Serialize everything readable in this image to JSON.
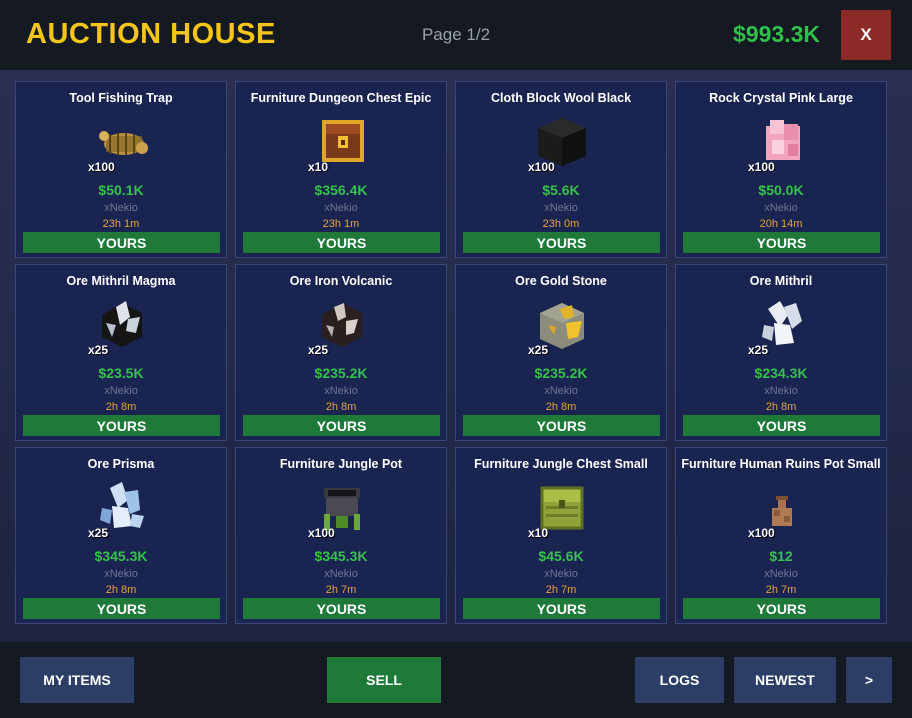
{
  "header": {
    "title": "AUCTION HOUSE",
    "page_indicator": "Page 1/2",
    "balance": "$993.3K",
    "close_label": "X"
  },
  "items": [
    {
      "name": "Tool Fishing Trap",
      "qty": "x100",
      "price": "$50.1K",
      "seller": "xNekio",
      "time": "23h 1m",
      "status": "YOURS",
      "icon": "fishing-trap-icon"
    },
    {
      "name": "Furniture Dungeon Chest Epic",
      "qty": "x10",
      "price": "$356.4K",
      "seller": "xNekio",
      "time": "23h 1m",
      "status": "YOURS",
      "icon": "dungeon-chest-icon"
    },
    {
      "name": "Cloth Block Wool Black",
      "qty": "x100",
      "price": "$5.6K",
      "seller": "xNekio",
      "time": "23h 0m",
      "status": "YOURS",
      "icon": "black-wool-block-icon"
    },
    {
      "name": "Rock Crystal Pink Large",
      "qty": "x100",
      "price": "$50.0K",
      "seller": "xNekio",
      "time": "20h 14m",
      "status": "YOURS",
      "icon": "pink-crystal-icon"
    },
    {
      "name": "Ore Mithril Magma",
      "qty": "x25",
      "price": "$23.5K",
      "seller": "xNekio",
      "time": "2h 8m",
      "status": "YOURS",
      "icon": "mithril-magma-ore-icon"
    },
    {
      "name": "Ore Iron Volcanic",
      "qty": "x25",
      "price": "$235.2K",
      "seller": "xNekio",
      "time": "2h 8m",
      "status": "YOURS",
      "icon": "iron-volcanic-ore-icon"
    },
    {
      "name": "Ore Gold Stone",
      "qty": "x25",
      "price": "$235.2K",
      "seller": "xNekio",
      "time": "2h 8m",
      "status": "YOURS",
      "icon": "gold-stone-ore-icon"
    },
    {
      "name": "Ore Mithril",
      "qty": "x25",
      "price": "$234.3K",
      "seller": "xNekio",
      "time": "2h 8m",
      "status": "YOURS",
      "icon": "mithril-ore-icon"
    },
    {
      "name": "Ore Prisma",
      "qty": "x25",
      "price": "$345.3K",
      "seller": "xNekio",
      "time": "2h 8m",
      "status": "YOURS",
      "icon": "prisma-ore-icon"
    },
    {
      "name": "Furniture Jungle Pot",
      "qty": "x100",
      "price": "$345.3K",
      "seller": "xNekio",
      "time": "2h 7m",
      "status": "YOURS",
      "icon": "jungle-pot-icon"
    },
    {
      "name": "Furniture Jungle Chest Small",
      "qty": "x10",
      "price": "$45.6K",
      "seller": "xNekio",
      "time": "2h 7m",
      "status": "YOURS",
      "icon": "jungle-chest-icon"
    },
    {
      "name": "Furniture Human Ruins Pot Small",
      "qty": "x100",
      "price": "$12",
      "seller": "xNekio",
      "time": "2h 7m",
      "status": "YOURS",
      "icon": "ruins-pot-icon"
    }
  ],
  "footer": {
    "my_items_label": "MY ITEMS",
    "sell_label": "SELL",
    "logs_label": "LOGS",
    "sort_label": "NEWEST",
    "next_label": ">"
  }
}
